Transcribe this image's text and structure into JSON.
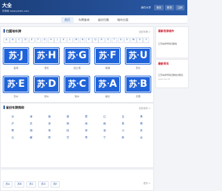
{
  "header": {
    "logo": "大全",
    "subtitle": "车牌网 www.paizhi.com",
    "buttons": [
      "我们大学",
      "首页",
      "登录",
      "注册"
    ]
  },
  "nav": {
    "items": [
      "首页",
      "车牌查询",
      "省份归属",
      "城市分类"
    ],
    "active_index": 0
  },
  "letters_panel": {
    "title": "归属地车牌",
    "more": "全部车牌 >",
    "letters": [
      "A",
      "B",
      "C",
      "D",
      "E",
      "F",
      "G",
      "H",
      "J",
      "K",
      "L",
      "M",
      "N",
      "P",
      "Q",
      "R",
      "S",
      "T",
      "U",
      "V",
      "W",
      "X",
      "Y"
    ],
    "plates_row1": [
      {
        "prov": "苏",
        "letter": "J",
        "caption": "盐城"
      },
      {
        "prov": "苏",
        "letter": "H",
        "caption": "淮安"
      },
      {
        "prov": "苏",
        "letter": "G",
        "caption": "连云港"
      },
      {
        "prov": "苏",
        "letter": "F",
        "caption": "南通"
      },
      {
        "prov": "苏",
        "letter": "U",
        "caption": "苏州"
      }
    ],
    "plates_row2": [
      {
        "prov": "苏",
        "letter": "E",
        "caption": "苏州"
      },
      {
        "prov": "苏",
        "letter": "D",
        "caption": "常州"
      },
      {
        "prov": "苏",
        "letter": "C",
        "caption": "徐州"
      },
      {
        "prov": "苏",
        "letter": "A",
        "caption": "南京"
      },
      {
        "prov": "苏",
        "letter": "B",
        "caption": "无锡"
      }
    ],
    "plate_color": "#1f63d9"
  },
  "province_panel": {
    "title": "省份车牌简称",
    "more": "全部省份 >",
    "provinces": [
      "京",
      "津",
      "冀",
      "晋",
      "蒙",
      "辽",
      "吉",
      "黑",
      "沪",
      "苏",
      "浙",
      "皖",
      "闽",
      "赣",
      "鲁",
      "豫",
      "鄂",
      "湘",
      "粤",
      "桂",
      "琼",
      "渝",
      "川",
      "贵",
      "云",
      "藏",
      "陕",
      "甘",
      "青",
      "宁",
      "新",
      "台"
    ]
  },
  "bottom_panel": {
    "more": "更多 >",
    "items": [
      "苏A",
      "苏B",
      "苏C",
      "苏D",
      "苏E"
    ]
  },
  "sidebar_latest": {
    "title": "最新收录城市",
    "items": [
      {
        "text": "江苏车牌号码归属地",
        "date": ""
      }
    ]
  },
  "sidebar_news": {
    "title": "最新资讯",
    "items": [
      {
        "text": "江苏车牌号码归属地对照表",
        "date": "2023-07-27"
      }
    ]
  }
}
